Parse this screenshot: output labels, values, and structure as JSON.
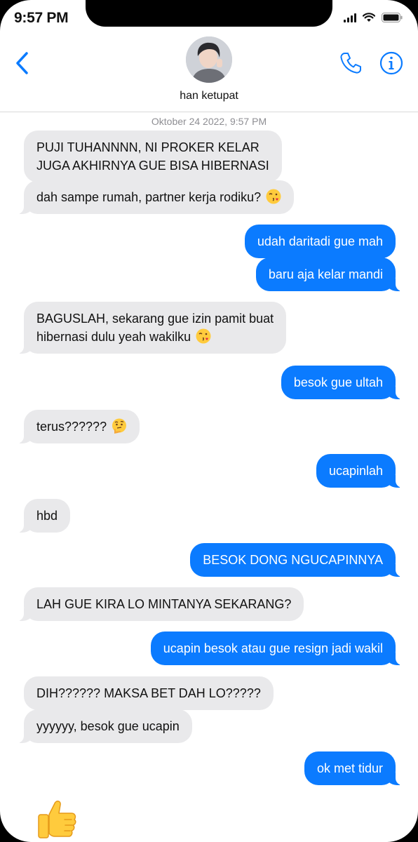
{
  "status_bar": {
    "time": "9:57 PM"
  },
  "header": {
    "contact_name": "han ketupat",
    "back_icon": "chevron-left-icon",
    "call_icon": "phone-icon",
    "info_icon": "info-icon",
    "accent_color": "#0b7bff"
  },
  "thread": {
    "timestamp": "Oktober 24 2022, 9:57 PM",
    "messages": [
      {
        "dir": "in",
        "lines": [
          "PUJI TUHANNNN, NI PROKER KELAR",
          "JUGA AKHIRNYA GUE BISA HIBERNASI"
        ]
      },
      {
        "dir": "in",
        "text": "dah sampe rumah, partner kerja rodiku?",
        "emoji": "kissing-face-emoji"
      },
      {
        "dir": "out",
        "text": "udah daritadi gue mah"
      },
      {
        "dir": "out",
        "text": "baru aja kelar mandi"
      },
      {
        "dir": "in",
        "lines": [
          "BAGUSLAH, sekarang gue izin pamit buat",
          "hibernasi dulu yeah wakilku"
        ],
        "emoji": "kissing-face-emoji"
      },
      {
        "dir": "out",
        "text": "besok gue ultah"
      },
      {
        "dir": "in",
        "text": "terus??????",
        "emoji": "thinking-face-emoji"
      },
      {
        "dir": "out",
        "text": "ucapinlah"
      },
      {
        "dir": "in",
        "text": "hbd"
      },
      {
        "dir": "out",
        "text": "BESOK DONG NGUCAPINNYA"
      },
      {
        "dir": "in",
        "text": "LAH GUE KIRA LO MINTANYA SEKARANG?"
      },
      {
        "dir": "out",
        "text": "ucapin besok atau gue resign jadi wakil"
      },
      {
        "dir": "in",
        "text": "DIH?????? MAKSA BET DAH LO?????"
      },
      {
        "dir": "in",
        "text": "yyyyyy, besok gue ucapin"
      },
      {
        "dir": "out",
        "text": "ok met tidur"
      },
      {
        "dir": "in",
        "emoji_only": "thumbs-up-emoji"
      }
    ],
    "colors": {
      "incoming": "#e9e9eb",
      "outgoing": "#0b7bff"
    }
  }
}
